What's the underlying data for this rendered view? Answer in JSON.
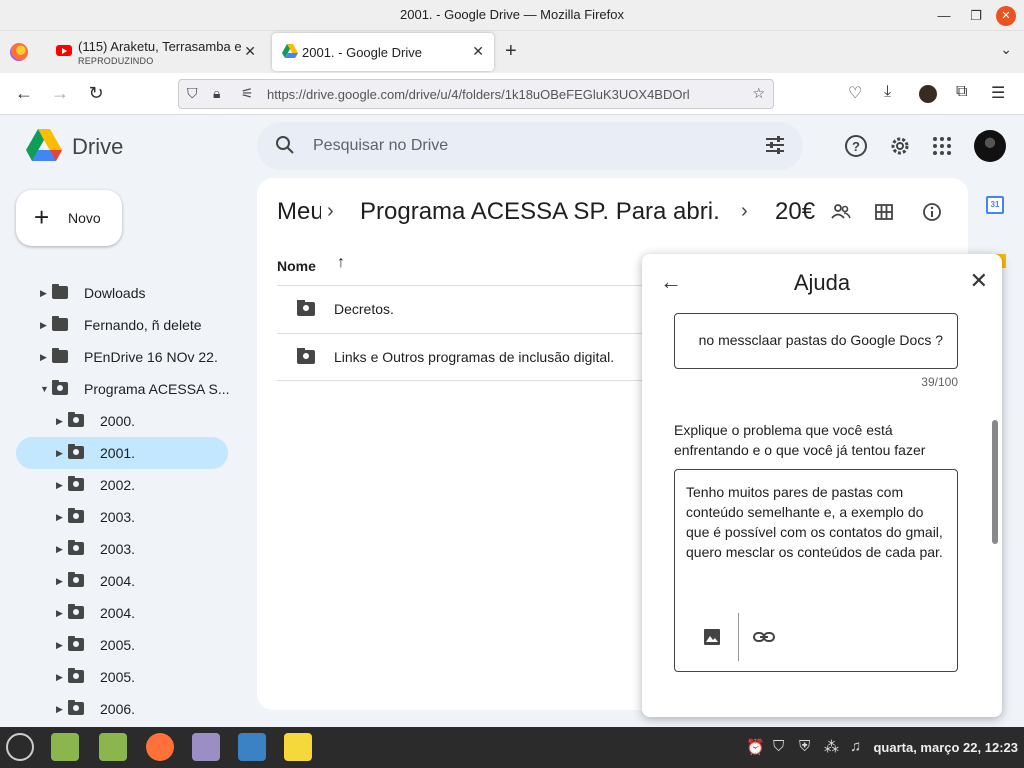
{
  "window": {
    "title": "2001. - Google Drive — Mozilla Firefox"
  },
  "tabs": [
    {
      "title": "(115) Araketu, Terrasamba e",
      "subtitle": "REPRODUZINDO",
      "icon": "youtube-icon"
    },
    {
      "title": "2001. - Google Drive",
      "icon": "google-drive-icon"
    }
  ],
  "url": "https://drive.google.com/drive/u/4/folders/1k18uOBeFEGluK3UOX4BDOrl",
  "drive": {
    "name": "Drive",
    "search_placeholder": "Pesquisar no Drive",
    "new_button": "Novo"
  },
  "tree": [
    {
      "label": "Dowloads",
      "shared": false,
      "level": 1,
      "expanded": false
    },
    {
      "label": "Fernando, ñ delete",
      "shared": false,
      "level": 1,
      "expanded": false
    },
    {
      "label": "PEnDrive 16 NOv 22.",
      "shared": false,
      "level": 1,
      "expanded": false
    },
    {
      "label": "Programa ACESSA S...",
      "shared": true,
      "level": 1,
      "expanded": true
    },
    {
      "label": "2000.",
      "shared": true,
      "level": 2,
      "expanded": false
    },
    {
      "label": "2001.",
      "shared": true,
      "level": 2,
      "expanded": false,
      "selected": true
    },
    {
      "label": "2002.",
      "shared": true,
      "level": 2,
      "expanded": false
    },
    {
      "label": "2003.",
      "shared": true,
      "level": 2,
      "expanded": false
    },
    {
      "label": "2003.",
      "shared": true,
      "level": 2,
      "expanded": false
    },
    {
      "label": "2004.",
      "shared": true,
      "level": 2,
      "expanded": false
    },
    {
      "label": "2004.",
      "shared": true,
      "level": 2,
      "expanded": false
    },
    {
      "label": "2005.",
      "shared": true,
      "level": 2,
      "expanded": false
    },
    {
      "label": "2005.",
      "shared": true,
      "level": 2,
      "expanded": false
    },
    {
      "label": "2006.",
      "shared": true,
      "level": 2,
      "expanded": false
    }
  ],
  "breadcrumb": [
    "Meu",
    "Programa ACESSA SP. Para abri...",
    "20€"
  ],
  "list": {
    "column": "Nome",
    "rows": [
      "Decretos.",
      "Links e Outros programas de inclusão digital."
    ]
  },
  "help": {
    "title": "Ajuda",
    "question": "no  messclaar pastas do Google Docs ?",
    "counter": "39/100",
    "describe_label": "Explique o problema que você está enfrentando e o que você já tentou fazer",
    "description": "Tenho muitos pares de  pastas  com conteúdo semelhante e,  a exemplo do que é  possível com os contatos do gmail,  quero mesclar os conteúdos de cada par."
  },
  "side_panel": {
    "calendar_day": "31"
  },
  "taskbar": {
    "clock": "quarta, março 22, 12:23"
  },
  "colors": {
    "accent": "#0b57d0",
    "selected": "#c2e7ff",
    "surface": "#f0f4f9"
  }
}
